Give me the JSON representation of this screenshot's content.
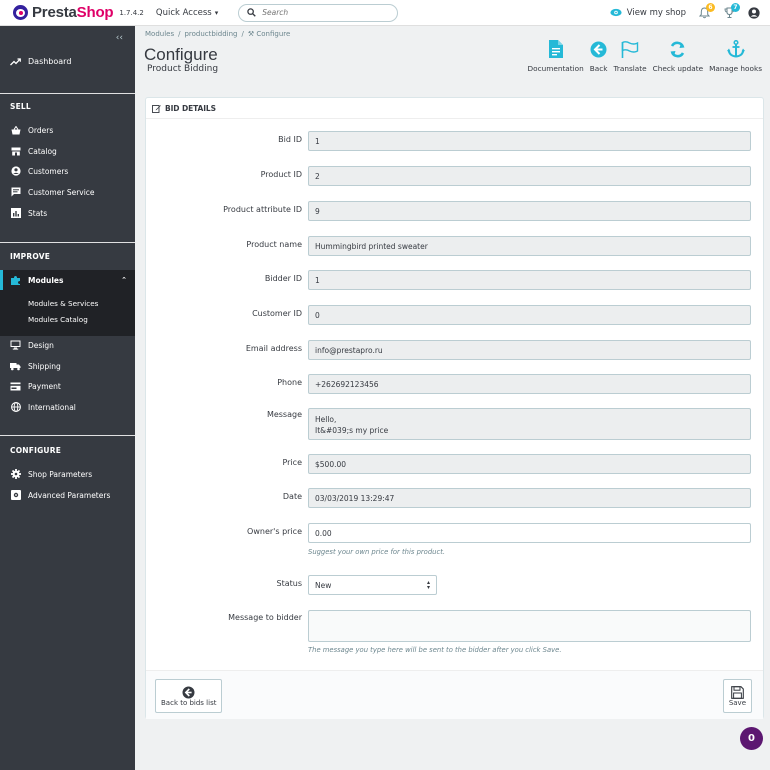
{
  "header": {
    "logo_prefix": "Presta",
    "logo_suffix": "Shop",
    "version": "1.7.4.2",
    "quick_access": "Quick Access",
    "search_placeholder": "Search",
    "view_shop": "View my shop",
    "orders_badge": "6",
    "customers_badge": "7"
  },
  "sidebar": {
    "dashboard": "Dashboard",
    "sections": {
      "sell": "SELL",
      "improve": "IMPROVE",
      "configure": "CONFIGURE"
    },
    "sell_items": [
      "Orders",
      "Catalog",
      "Customers",
      "Customer Service",
      "Stats"
    ],
    "improve_active": "Modules",
    "modules_sub": [
      "Modules & Services",
      "Modules Catalog"
    ],
    "improve_items": [
      "Design",
      "Shipping",
      "Payment",
      "International"
    ],
    "configure_items": [
      "Shop Parameters",
      "Advanced Parameters"
    ]
  },
  "page": {
    "breadcrumb": [
      "Modules",
      "productbidding",
      "Configure"
    ],
    "title": "Configure",
    "subtitle": "Product Bidding",
    "toolbar": [
      "Documentation",
      "Back",
      "Translate",
      "Check update",
      "Manage hooks"
    ]
  },
  "panel": {
    "title": "BID DETAILS",
    "fields": [
      {
        "label": "Bid ID",
        "value": "1"
      },
      {
        "label": "Product ID",
        "value": "2"
      },
      {
        "label": "Product attribute ID",
        "value": "9"
      },
      {
        "label": "Product name",
        "value": "Hummingbird printed sweater"
      },
      {
        "label": "Bidder ID",
        "value": "1"
      },
      {
        "label": "Customer ID",
        "value": "0"
      },
      {
        "label": "Email address",
        "value": "info@prestapro.ru"
      },
      {
        "label": "Phone",
        "value": "+262692123456"
      },
      {
        "label": "Message",
        "value": "Hello,\nIt&#039;s my price"
      },
      {
        "label": "Price",
        "value": "$500.00"
      },
      {
        "label": "Date",
        "value": "03/03/2019 13:29:47"
      },
      {
        "label": "Owner's price",
        "value": "0.00"
      }
    ],
    "owner_price_help": "Suggest your own price for this product.",
    "status_label": "Status",
    "status_value": "New",
    "message_to_bidder_label": "Message to bidder",
    "message_to_bidder_value": "",
    "message_help": "The message you type here will be sent to the bidder after you click Save.",
    "back_button": "Back to bids list",
    "save_button": "Save"
  },
  "help_bubble": "0",
  "colors": {
    "brand_purple": "#34219e",
    "brand_pink": "#df0067",
    "accent": "#25b9d7",
    "sidebar": "#363a41"
  }
}
